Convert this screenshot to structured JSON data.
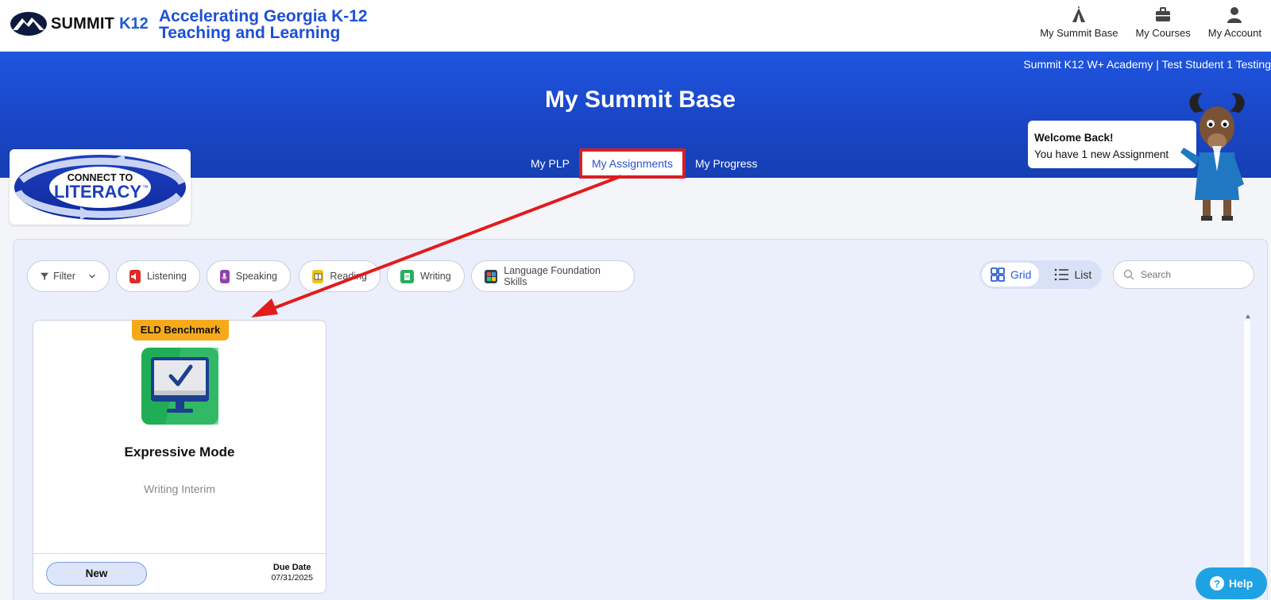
{
  "brand": {
    "summit": "SUMMIT",
    "k12": "K12",
    "tagline_line1": "Accelerating Georgia K-12",
    "tagline_line2": "Teaching and Learning"
  },
  "topnav": [
    {
      "label": "My Summit Base",
      "icon": "tent-icon"
    },
    {
      "label": "My Courses",
      "icon": "briefcase-icon"
    },
    {
      "label": "My Account",
      "icon": "user-icon"
    }
  ],
  "banner": {
    "user_info": "Summit K12 W+ Academy | Test Student 1 Testing",
    "title": "My Summit Base",
    "tabs": [
      {
        "label": "My PLP",
        "active": false
      },
      {
        "label": "My Assignments",
        "active": true
      },
      {
        "label": "My Progress",
        "active": false
      }
    ]
  },
  "logo": {
    "line1": "CONNECT TO",
    "line2": "LITERACY",
    "tm": "™"
  },
  "welcome": {
    "title": "Welcome Back!",
    "message": "You have 1 new Assignment"
  },
  "filters": {
    "filter_label": "Filter",
    "chips": [
      {
        "label": "Listening",
        "color": "#e02a2a"
      },
      {
        "label": "Speaking",
        "color": "#8e44ad"
      },
      {
        "label": "Reading",
        "color": "#f0c419"
      },
      {
        "label": "Writing",
        "color": "#27ae60"
      },
      {
        "label": "Language Foundation Skills",
        "color": "#2c3e50"
      }
    ]
  },
  "view": {
    "grid": "Grid",
    "list": "List",
    "selected": "Grid"
  },
  "search": {
    "placeholder": "Search"
  },
  "assignments": [
    {
      "badge": "ELD Benchmark",
      "title": "Expressive Mode",
      "subtitle": "Writing Interim",
      "status": "New",
      "due_label": "Due Date",
      "due_date": "07/31/2025"
    }
  ],
  "help": {
    "label": "Help"
  },
  "colors": {
    "primary": "#1d4fd8",
    "banner": "#1a47c8",
    "accent_badge": "#f5a91b",
    "highlight": "#d61f26",
    "help": "#1ea2e4"
  }
}
